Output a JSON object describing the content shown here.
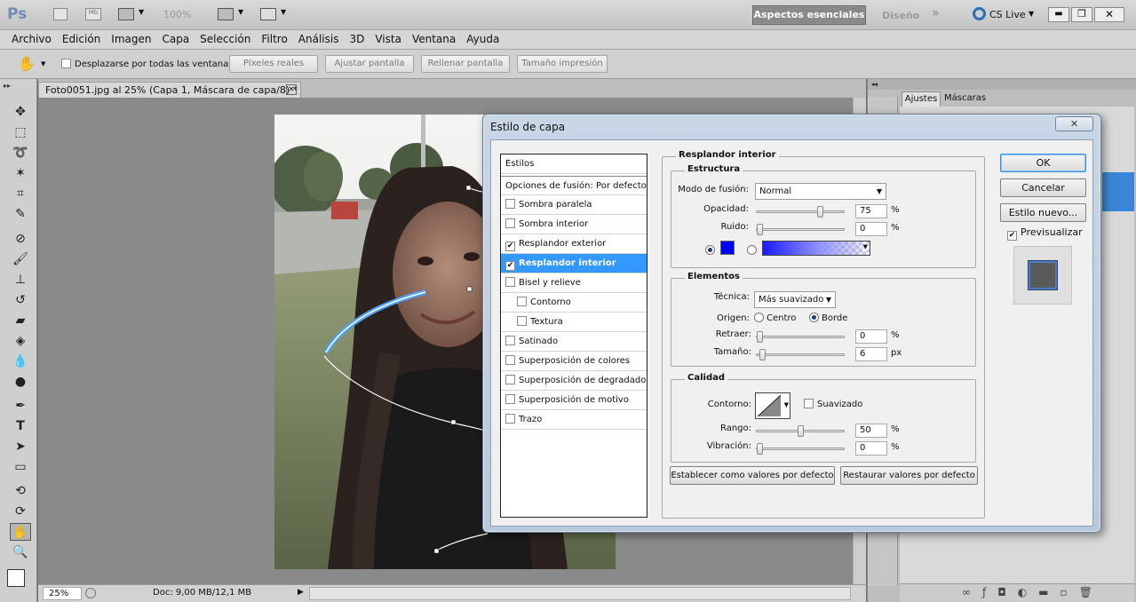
{
  "app": {
    "logo": "Ps",
    "zoom": "100%",
    "workspace_active": "Aspectos esenciales",
    "workspace_other": "Diseño",
    "cslive": "CS Live"
  },
  "menu": [
    "Archivo",
    "Edición",
    "Imagen",
    "Capa",
    "Selección",
    "Filtro",
    "Análisis",
    "3D",
    "Vista",
    "Ventana",
    "Ayuda"
  ],
  "options": {
    "scroll_all": "Desplazarse por todas las ventanas",
    "b1": "Píxeles reales",
    "b2": "Ajustar pantalla",
    "b3": "Rellenar pantalla",
    "b4": "Tamaño impresión"
  },
  "document": {
    "tab": "Foto0051.jpg al 25% (Capa 1, Máscara de capa/8) *",
    "zoom": "25%",
    "docsize": "Doc: 9,00 MB/12,1 MB"
  },
  "panel": {
    "tab1": "Ajustes",
    "tab2": "Máscaras"
  },
  "dialog": {
    "title": "Estilo de capa",
    "styles": [
      {
        "label": "Estilos",
        "checkbox": false
      },
      {
        "label": "Opciones de fusión: Por defecto",
        "checkbox": false
      },
      {
        "label": "Sombra paralela",
        "checkbox": true,
        "checked": false
      },
      {
        "label": "Sombra interior",
        "checkbox": true,
        "checked": false
      },
      {
        "label": "Resplandor exterior",
        "checkbox": true,
        "checked": true
      },
      {
        "label": "Resplandor interior",
        "checkbox": true,
        "checked": true,
        "selected": true
      },
      {
        "label": "Bisel y relieve",
        "checkbox": true,
        "checked": false
      },
      {
        "label": "Contorno",
        "checkbox": true,
        "checked": false,
        "indent": true
      },
      {
        "label": "Textura",
        "checkbox": true,
        "checked": false,
        "indent": true
      },
      {
        "label": "Satinado",
        "checkbox": true,
        "checked": false
      },
      {
        "label": "Superposición de colores",
        "checkbox": true,
        "checked": false
      },
      {
        "label": "Superposición de degradado",
        "checkbox": true,
        "checked": false
      },
      {
        "label": "Superposición de motivo",
        "checkbox": true,
        "checked": false
      },
      {
        "label": "Trazo",
        "checkbox": true,
        "checked": false
      }
    ],
    "section": "Resplandor interior",
    "estructura": {
      "title": "Estructura",
      "blend_label": "Modo de fusión:",
      "blend_value": "Normal",
      "opacity_label": "Opacidad:",
      "opacity": "75",
      "noise_label": "Ruido:",
      "noise": "0",
      "pct": "%",
      "opacity_level": 0.75,
      "noise_level": 0.0,
      "color": "#0000ff"
    },
    "elementos": {
      "title": "Elementos",
      "technique_label": "Técnica:",
      "technique": "Más suavizado",
      "source_label": "Origen:",
      "source_center": "Centro",
      "source_edge": "Borde",
      "choke_label": "Retraer:",
      "choke": "0",
      "size_label": "Tamaño:",
      "size": "6",
      "px": "px",
      "pct": "%",
      "choke_level": 0.0,
      "size_level": 0.03
    },
    "calidad": {
      "title": "Calidad",
      "contour_label": "Contorno:",
      "antialias": "Suavizado",
      "range_label": "Rango:",
      "range": "50",
      "jitter_label": "Vibración:",
      "jitter": "0",
      "pct": "%",
      "range_level": 0.5,
      "jitter_level": 0.0
    },
    "btn_default": "Establecer como valores por defecto",
    "btn_reset": "Restaurar valores por defecto",
    "ok": "OK",
    "cancel": "Cancelar",
    "new_style": "Estilo nuevo...",
    "preview": "Previsualizar"
  }
}
